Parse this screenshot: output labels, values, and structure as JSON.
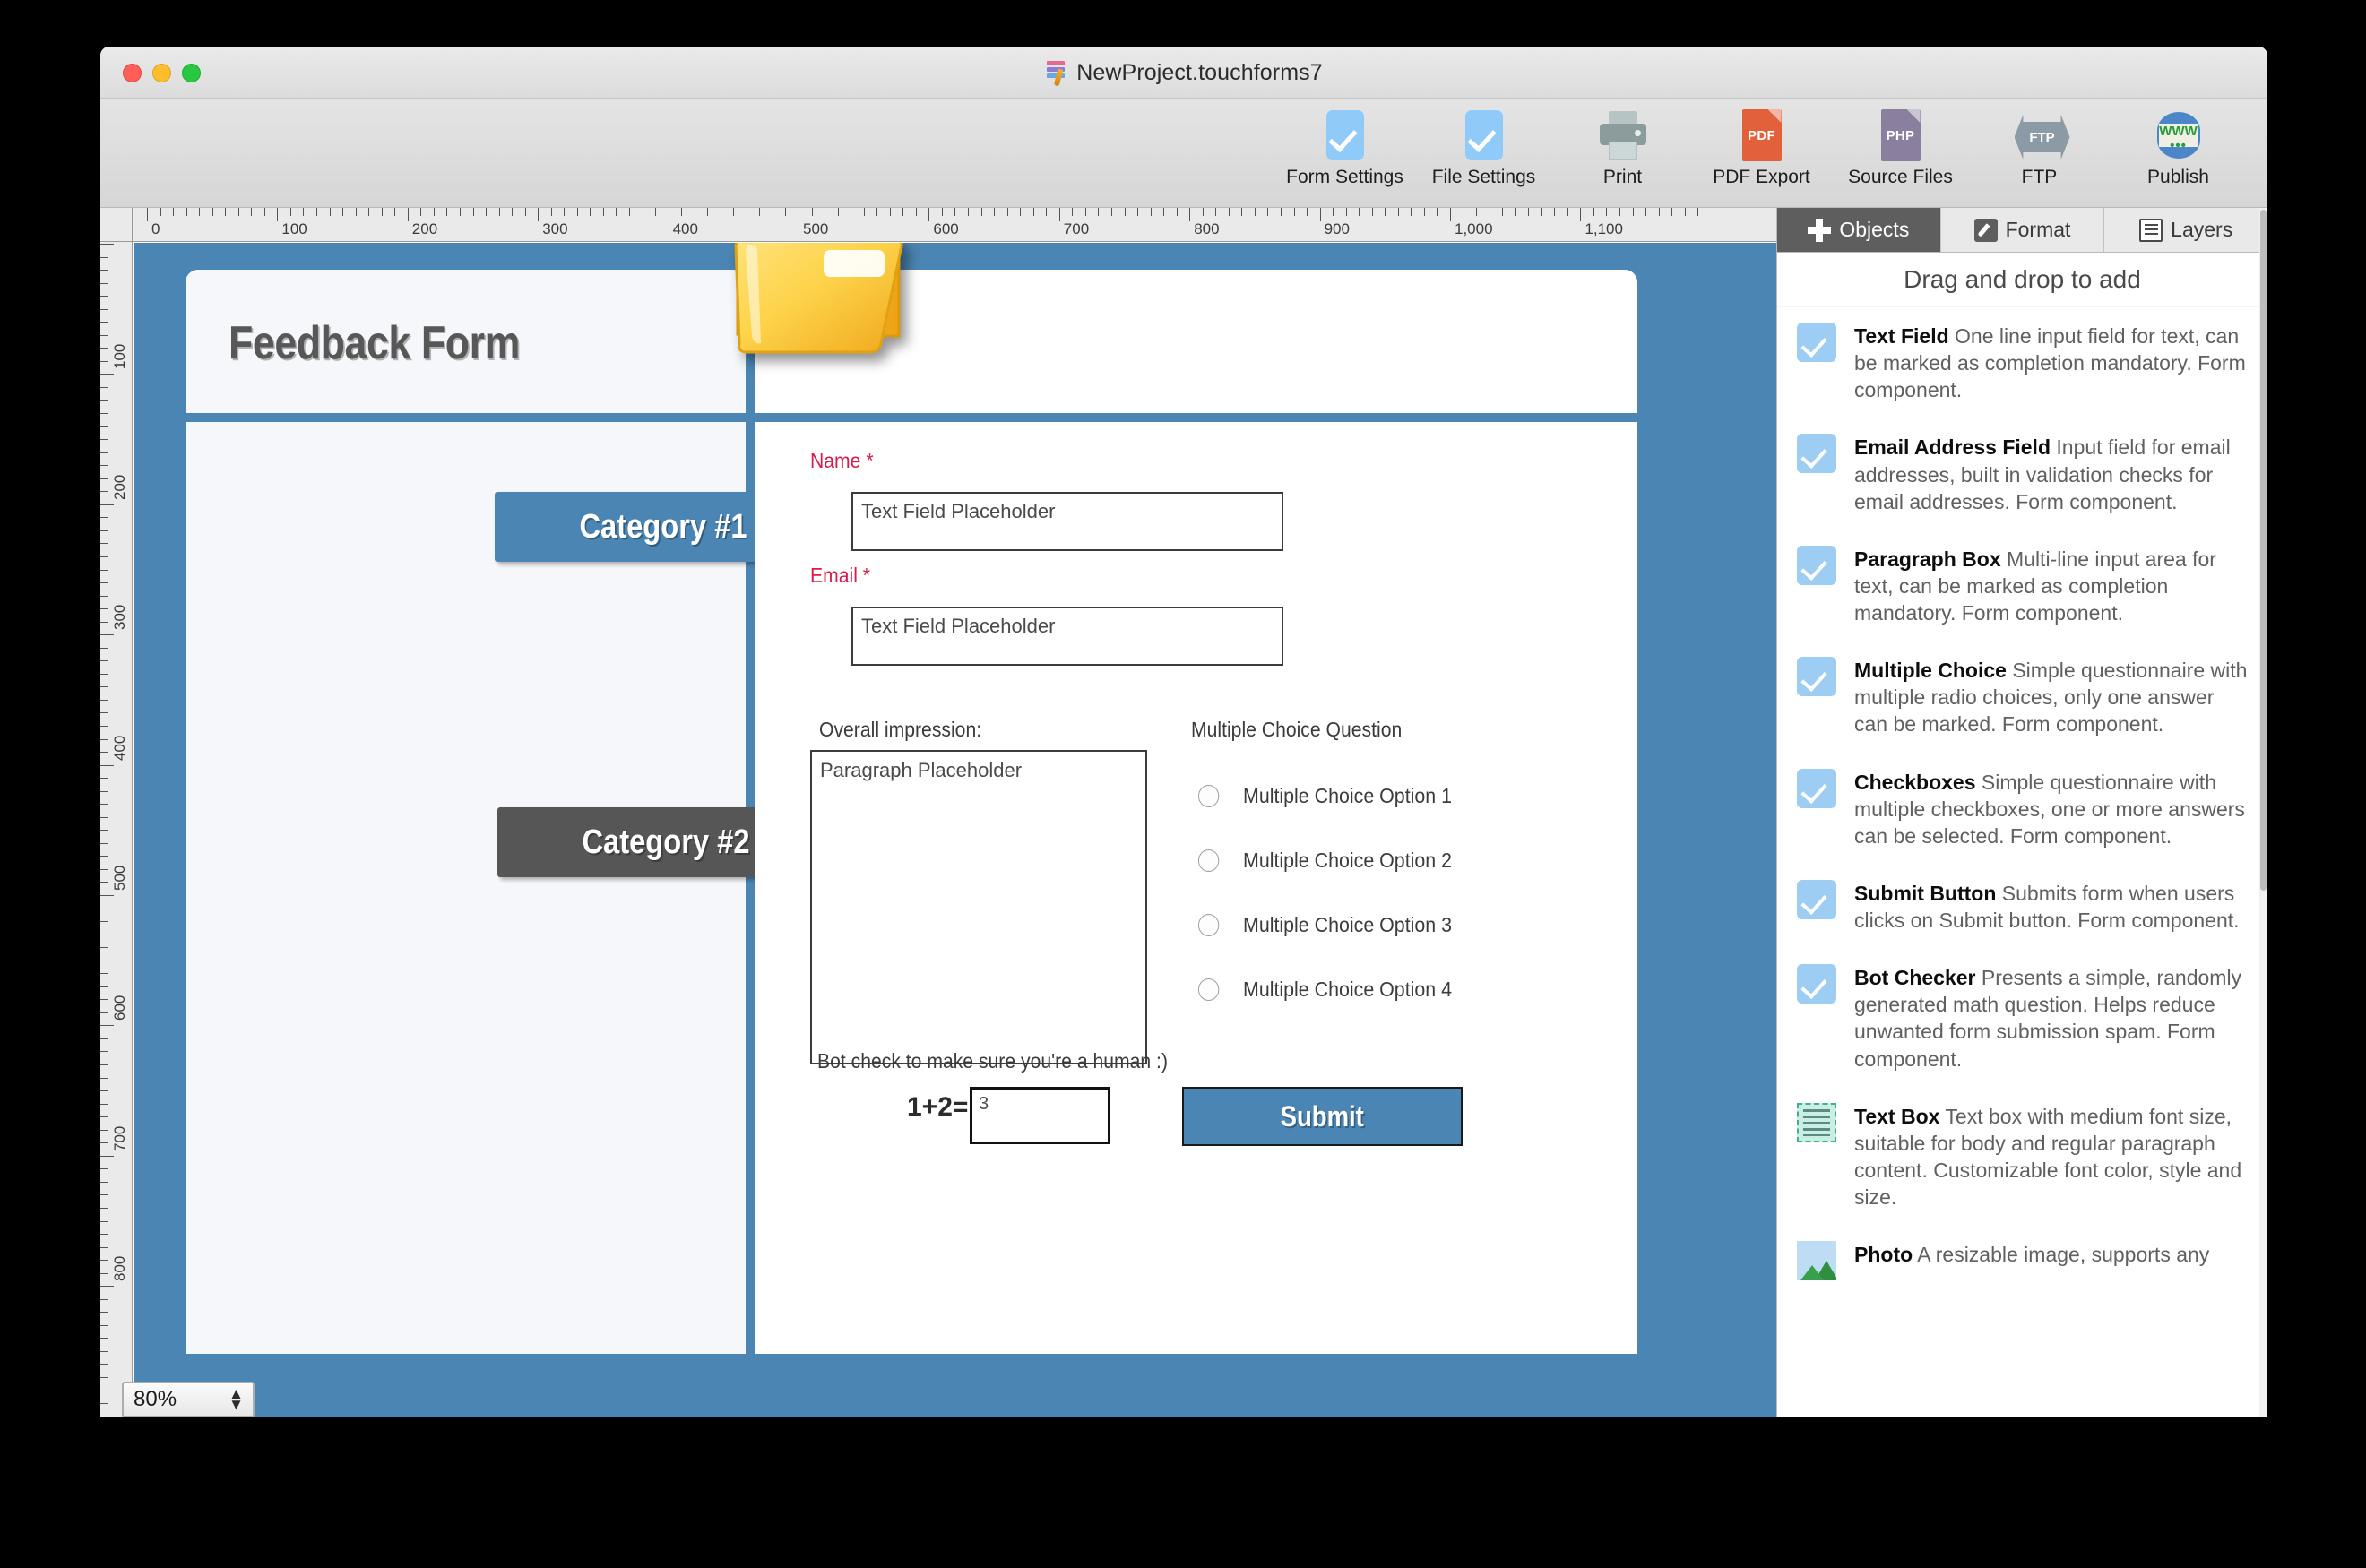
{
  "window": {
    "title": "NewProject.touchforms7",
    "doc_icon": "touchforms-document-icon",
    "controls": {
      "close": "close-button",
      "minimize": "minimize-button",
      "maximize": "maximize-button"
    }
  },
  "toolbar": {
    "items": [
      {
        "label": "Form Settings",
        "icon": "blue-checkmark-icon"
      },
      {
        "label": "File Settings",
        "icon": "blue-checkmark-icon"
      },
      {
        "label": "Print",
        "icon": "printer-icon"
      },
      {
        "label": "PDF Export",
        "icon": "pdf-file-icon",
        "tag": "PDF"
      },
      {
        "label": "Source Files",
        "icon": "php-file-icon",
        "tag": "PHP"
      },
      {
        "label": "FTP",
        "icon": "ftp-arrows-icon",
        "tag": "FTP"
      },
      {
        "label": "Publish",
        "icon": "www-globe-icon",
        "tag_top": "WWW",
        "tag_bottom": "•••"
      }
    ]
  },
  "editor": {
    "ruler": {
      "h_labels": [
        "0",
        "100",
        "200",
        "300",
        "400",
        "500",
        "600",
        "700",
        "800",
        "900",
        "1,000",
        "1,100"
      ],
      "v_labels": [
        "100",
        "200",
        "300",
        "400",
        "500",
        "600",
        "700",
        "800"
      ],
      "unit_step": 100,
      "minor_per_major": 10
    },
    "zoom": {
      "value": "80%",
      "stepper_up": "▲",
      "stepper_down": "▼"
    },
    "canvas_bg": "#4b85b3"
  },
  "form": {
    "title": "Feedback Form",
    "folder_icon": "yellow-folder-icon",
    "categories": [
      {
        "label": "Category #1",
        "color": "#4b85b3"
      },
      {
        "label": "Category #2",
        "color": "#565656"
      }
    ],
    "fields": [
      {
        "label": "Name *",
        "placeholder": "Text Field Placeholder"
      },
      {
        "label": "Email *",
        "placeholder": "Text Field Placeholder"
      }
    ],
    "paragraph": {
      "label": "Overall impression:",
      "placeholder": "Paragraph Placeholder"
    },
    "multiple_choice": {
      "question": "Multiple Choice Question",
      "options": [
        "Multiple Choice Option 1",
        "Multiple Choice Option 2",
        "Multiple Choice Option 3",
        "Multiple Choice Option 4"
      ]
    },
    "bot_check": {
      "label": "Bot check to make sure you're a human :)",
      "equation": "1+2=",
      "answer": "3"
    },
    "submit": {
      "label": "Submit",
      "color": "#4b85b3"
    }
  },
  "inspector": {
    "tabs": [
      {
        "label": "Objects",
        "icon": "plus-icon",
        "active": true
      },
      {
        "label": "Format",
        "icon": "pencil-icon",
        "active": false
      },
      {
        "label": "Layers",
        "icon": "list-icon",
        "active": false
      }
    ],
    "hint": "Drag and drop to add",
    "objects": [
      {
        "icon": "blue-checkmark-icon",
        "name": "Text Field",
        "desc": "One line input field for text, can be marked as completion mandatory.  Form component."
      },
      {
        "icon": "blue-checkmark-icon",
        "name": "Email Address Field",
        "desc": "Input field for email addresses, built in validation checks for email addresses.  Form component."
      },
      {
        "icon": "blue-checkmark-icon",
        "name": "Paragraph Box",
        "desc": "Multi-line input area for text, can be marked as completion mandatory.  Form component."
      },
      {
        "icon": "blue-checkmark-icon",
        "name": "Multiple Choice",
        "desc": "Simple questionnaire with multiple radio choices, only one answer can be marked.  Form component."
      },
      {
        "icon": "blue-checkmark-icon",
        "name": "Checkboxes",
        "desc": "Simple questionnaire with multiple checkboxes, one or more answers can be selected.  Form component."
      },
      {
        "icon": "blue-checkmark-icon",
        "name": "Submit Button",
        "desc": "Submits form when users clicks on Submit button.  Form component."
      },
      {
        "icon": "blue-checkmark-icon",
        "name": "Bot Checker",
        "desc": "Presents a simple, randomly generated math question.  Helps reduce unwanted form submission spam.  Form component."
      },
      {
        "icon": "text-box-icon",
        "name": "Text Box",
        "desc": "Text box with medium font size, suitable for body and regular paragraph content. Customizable font color, style and size."
      },
      {
        "icon": "photo-icon",
        "name": "Photo",
        "desc": "A resizable image, supports any"
      }
    ]
  }
}
